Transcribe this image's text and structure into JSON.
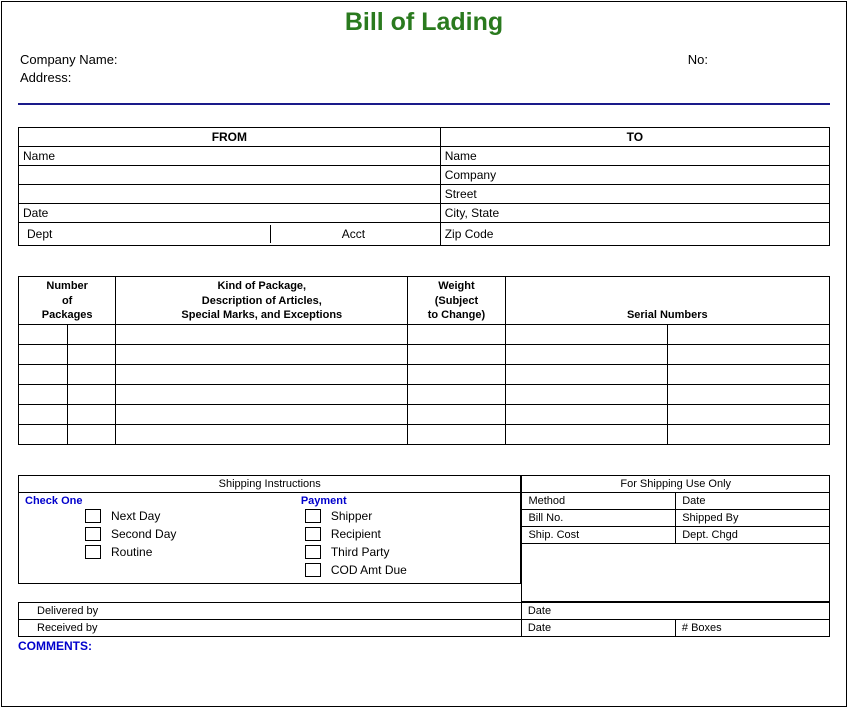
{
  "title": "Bill of Lading",
  "header": {
    "company_label": "Company Name:",
    "address_label": "Address:",
    "no_label": "No:"
  },
  "from_to": {
    "from_header": "FROM",
    "to_header": "TO",
    "from": {
      "name": "Name",
      "blank1": "",
      "blank2": "",
      "date": "Date",
      "dept": "Dept",
      "acct": "Acct"
    },
    "to": {
      "name": "Name",
      "company": "Company",
      "street": "Street",
      "city_state": "City, State",
      "zip": "Zip Code"
    }
  },
  "items": {
    "h_number_l1": "Number",
    "h_number_l2": "of",
    "h_number_l3": "Packages",
    "h_kind_l1": "Kind of Package,",
    "h_kind_l2": "Description of Articles,",
    "h_kind_l3": "Special Marks, and Exceptions",
    "h_weight_l1": "Weight",
    "h_weight_l2": "(Subject",
    "h_weight_l3": "to Change)",
    "h_serial": "Serial Numbers"
  },
  "shipping_instructions": {
    "header": "Shipping Instructions",
    "check_one": "Check One",
    "payment": "Payment",
    "options": {
      "next_day": "Next Day",
      "second_day": "Second Day",
      "routine": "Routine"
    },
    "pay_options": {
      "shipper": "Shipper",
      "recipient": "Recipient",
      "third_party": "Third Party",
      "cod": "COD Amt  Due"
    }
  },
  "shipping_only": {
    "header": "For Shipping Use Only",
    "method": "Method",
    "date": "Date",
    "bill_no": "Bill No.",
    "shipped_by": "Shipped By",
    "ship_cost": "Ship. Cost",
    "dept_chgd": "Dept. Chgd"
  },
  "delivery": {
    "delivered_by": "Delivered by",
    "received_by": "Received by",
    "date": "Date",
    "boxes": "# Boxes"
  },
  "comments_label": "COMMENTS:"
}
